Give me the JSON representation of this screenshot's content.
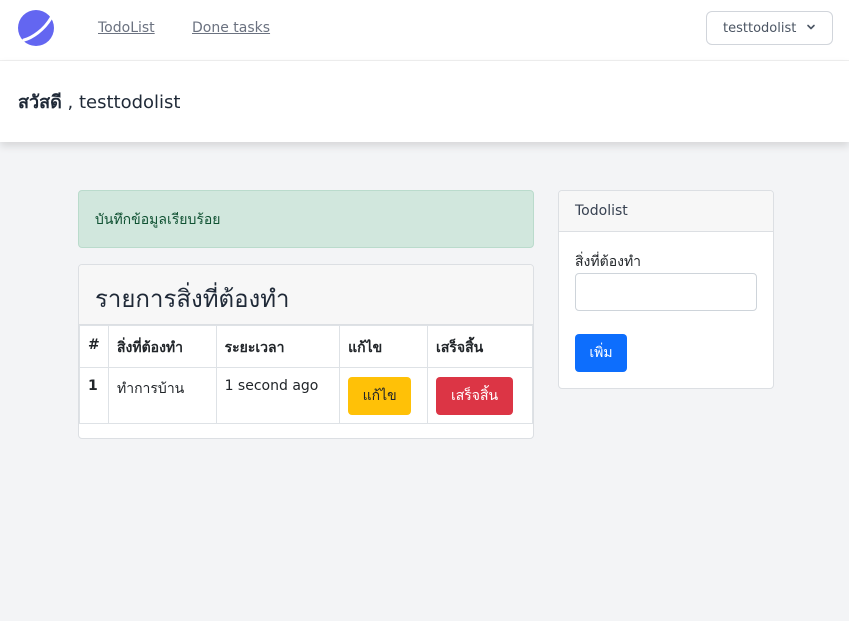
{
  "nav": {
    "todolist": "TodoList",
    "done_tasks": "Done tasks",
    "user": "testtodolist"
  },
  "header": {
    "greeting": "สวัสดี",
    "username": " , testtodolist"
  },
  "alert": {
    "message": "บันทึกข้อมูลเรียบร้อย"
  },
  "list": {
    "title": "รายการสิ่งที่ต้องทำ",
    "columns": [
      "#",
      "สิ่งที่ต้องทำ",
      "ระยะเวลา",
      "แก้ไข",
      "เสร็จสิ้น"
    ],
    "rows": [
      {
        "index": "1",
        "task": "ทำการบ้าน",
        "time": "1 second ago",
        "edit_label": "แก้ไข",
        "done_label": "เสร็จสิ้น"
      }
    ]
  },
  "form": {
    "title": "Todolist",
    "field_label": "สิ่งที่ต้องทำ",
    "field_value": "",
    "add_label": "เพิ่ม"
  },
  "colors": {
    "primary": "#0d6efd",
    "warning": "#ffc107",
    "danger": "#dc3545",
    "success_bg": "#d1e7dd",
    "logo": "#6366f1"
  }
}
